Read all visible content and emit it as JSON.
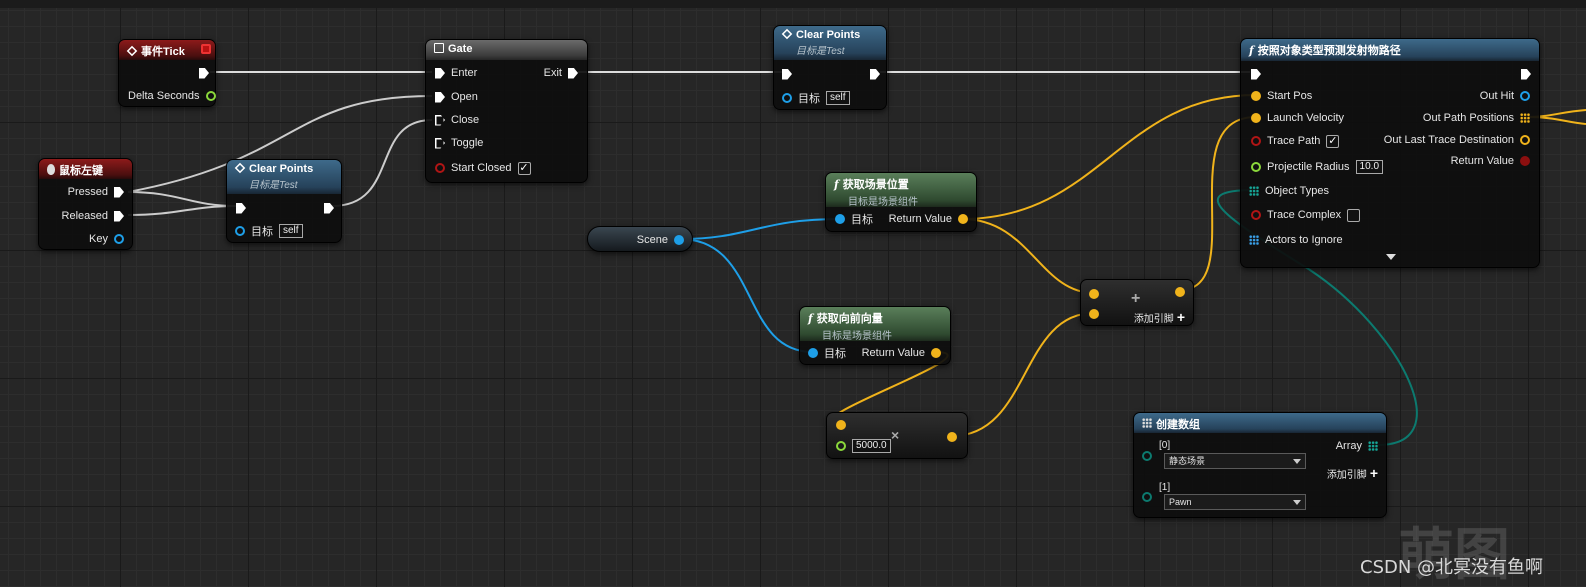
{
  "nodes": {
    "event_tick": {
      "title": "事件Tick",
      "delta_seconds": "Delta Seconds"
    },
    "mouse_left": {
      "title": "鼠标左键",
      "pressed": "Pressed",
      "released": "Released",
      "key": "Key"
    },
    "clear_points_1": {
      "title": "Clear Points",
      "subtitle": "目标是Test",
      "target_label": "目标",
      "target_value": "self"
    },
    "gate": {
      "title": "Gate",
      "enter": "Enter",
      "exit": "Exit",
      "open": "Open",
      "close": "Close",
      "toggle": "Toggle",
      "start_closed": "Start Closed"
    },
    "clear_points_2": {
      "title": "Clear Points",
      "subtitle": "目标是Test",
      "target_label": "目标",
      "target_value": "self"
    },
    "get_world_location": {
      "title": "获取场景位置",
      "subtitle": "目标是场景组件",
      "target_label": "目标",
      "return_value": "Return Value"
    },
    "scene_var": {
      "label": "Scene"
    },
    "get_forward_vector": {
      "title": "获取向前向量",
      "subtitle": "目标是场景组件",
      "target_label": "目标",
      "return_value": "Return Value"
    },
    "multiply": {
      "value": "5000.0",
      "symbol": "×"
    },
    "add": {
      "symbol": "+",
      "add_pin": "添加引脚"
    },
    "predict_path": {
      "title": "按照对象类型预测发射物路径",
      "start_pos": "Start Pos",
      "launch_velocity": "Launch Velocity",
      "trace_path": "Trace Path",
      "projectile_radius": "Projectile Radius",
      "projectile_radius_value": "10.0",
      "object_types": "Object Types",
      "trace_complex": "Trace Complex",
      "actors_to_ignore": "Actors to Ignore",
      "out_hit": "Out Hit",
      "out_path_positions": "Out Path Positions",
      "out_last_trace_destination": "Out Last Trace Destination",
      "return_value": "Return Value"
    },
    "make_array": {
      "title": "创建数组",
      "index0": "[0]",
      "value0": "静态场景",
      "index1": "[1]",
      "value1": "Pawn",
      "array": "Array",
      "add_pin": "添加引脚"
    }
  },
  "watermark": "CSDN @北冥没有鱼啊",
  "colors": {
    "exec": "#ffffff",
    "vector": "#f0b31b",
    "object": "#1e9fe8",
    "float": "#8bd83b",
    "bool": "#8c0f0f",
    "object_type": "#0c7a6f"
  }
}
